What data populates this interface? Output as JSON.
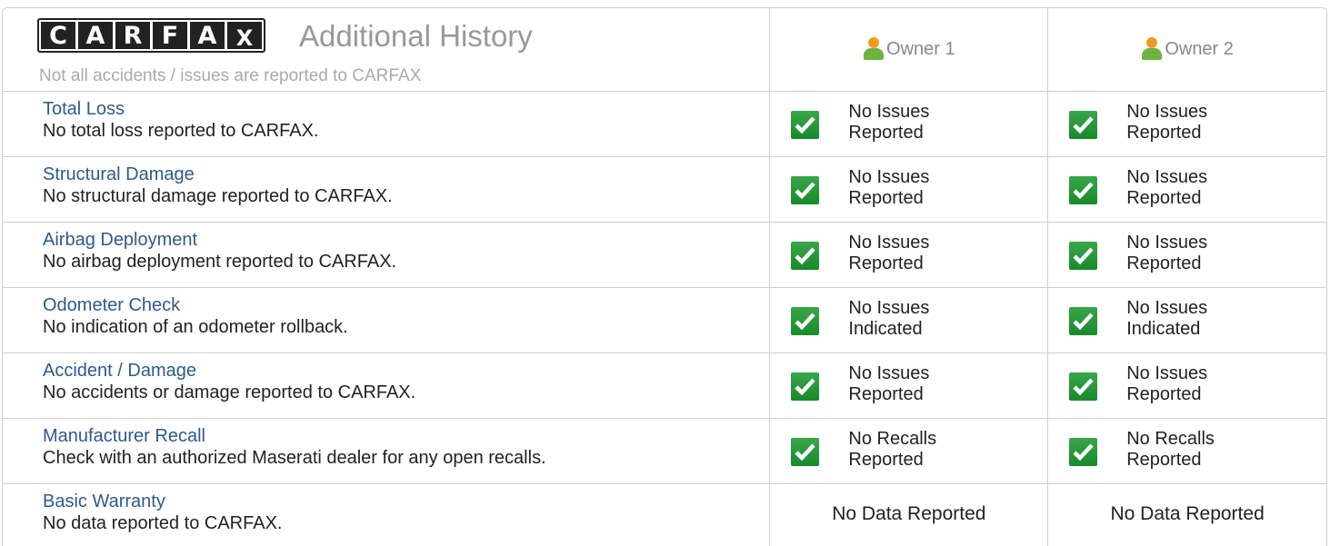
{
  "header": {
    "logo_letters": [
      "C",
      "A",
      "R",
      "F",
      "A",
      "X"
    ],
    "title": "Additional History",
    "subtitle": "Not all accidents / issues are reported to CARFAX",
    "owners": [
      "Owner 1",
      "Owner 2"
    ]
  },
  "rows": [
    {
      "title": "Total Loss",
      "desc": "No total loss reported to CARFAX.",
      "o1": {
        "line1": "No Issues",
        "line2": "Reported"
      },
      "o2": {
        "line1": "No Issues",
        "line2": "Reported"
      }
    },
    {
      "title": "Structural Damage",
      "desc": "No structural damage reported to CARFAX.",
      "o1": {
        "line1": "No Issues",
        "line2": "Reported"
      },
      "o2": {
        "line1": "No Issues",
        "line2": "Reported"
      }
    },
    {
      "title": "Airbag Deployment",
      "desc": "No airbag deployment reported to CARFAX.",
      "o1": {
        "line1": "No Issues",
        "line2": "Reported"
      },
      "o2": {
        "line1": "No Issues",
        "line2": "Reported"
      }
    },
    {
      "title": "Odometer Check",
      "desc": "No indication of an odometer rollback.",
      "o1": {
        "line1": "No Issues",
        "line2": "Indicated"
      },
      "o2": {
        "line1": "No Issues",
        "line2": "Indicated"
      }
    },
    {
      "title": "Accident / Damage",
      "desc": "No accidents or damage reported to CARFAX.",
      "o1": {
        "line1": "No Issues",
        "line2": "Reported"
      },
      "o2": {
        "line1": "No Issues",
        "line2": "Reported"
      }
    },
    {
      "title": "Manufacturer Recall",
      "desc": "Check with an authorized Maserati dealer for any open recalls.",
      "o1": {
        "line1": "No Recalls",
        "line2": "Reported"
      },
      "o2": {
        "line1": "No Recalls",
        "line2": "Reported"
      }
    },
    {
      "title": "Basic Warranty",
      "desc": "No data reported to CARFAX.",
      "o1_nodata": "No Data Reported",
      "o2_nodata": "No Data Reported"
    }
  ],
  "colors": {
    "link": "#2e5a8c",
    "check_green": "#178a2c",
    "border": "#cfcfcf"
  },
  "icons": {
    "owner": "person-icon",
    "status": "checkmark-icon"
  }
}
